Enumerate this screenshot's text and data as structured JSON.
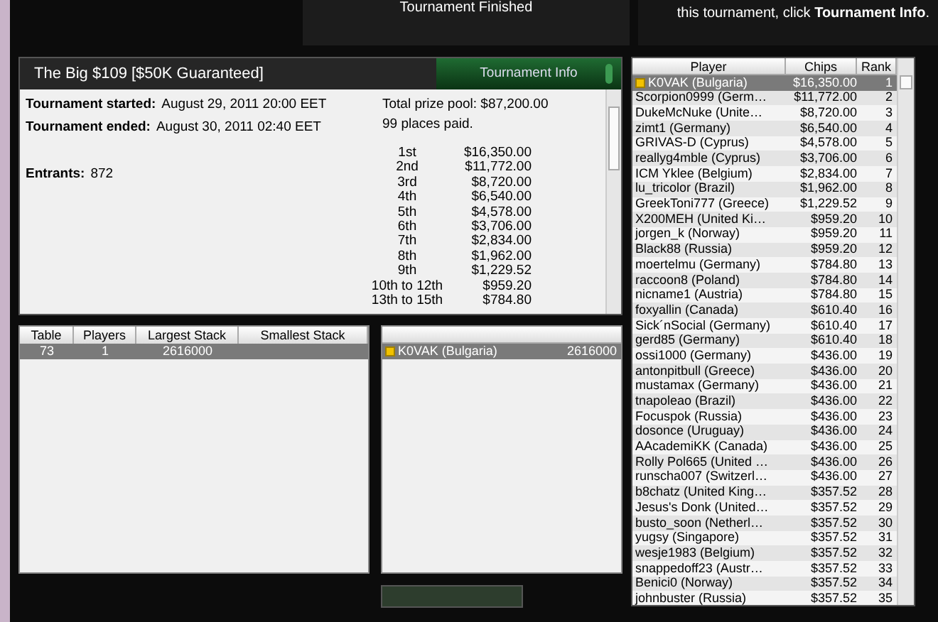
{
  "header": {
    "status": "Tournament Finished",
    "hint": "this tournament, click **Tournament Info**."
  },
  "info_panel": {
    "title": "The Big $109 [$50K Guaranteed]",
    "button": "Tournament Info",
    "fields": [
      {
        "label": "Tournament started:",
        "value": "August 29, 2011 20:00 EET"
      },
      {
        "label": "Tournament ended:",
        "value": "August 30, 2011 02:40 EET"
      },
      {
        "label": "Entrants:",
        "value": "872"
      }
    ],
    "prize_pool": "Total prize pool: $87,200.00",
    "places_paid": "99 places paid.",
    "payouts": [
      [
        "1st",
        "$16,350.00"
      ],
      [
        "2nd",
        "$11,772.00"
      ],
      [
        "3rd",
        "$8,720.00"
      ],
      [
        "4th",
        "$6,540.00"
      ],
      [
        "5th",
        "$4,578.00"
      ],
      [
        "6th",
        "$3,706.00"
      ],
      [
        "7th",
        "$2,834.00"
      ],
      [
        "8th",
        "$1,962.00"
      ],
      [
        "9th",
        "$1,229.52"
      ],
      [
        "10th to 12th",
        "$959.20"
      ],
      [
        "13th to 15th",
        "$784.80"
      ]
    ]
  },
  "tables": {
    "columns": [
      "Table",
      "Players",
      "Largest Stack",
      "Smallest Stack"
    ],
    "rows": [
      {
        "cells": [
          "73",
          "1",
          "2616000"
        ],
        "selected": true
      }
    ]
  },
  "table_players": [
    {
      "name": "K0VAK (Bulgaria)",
      "stack": "2616000",
      "selected": true,
      "hero": true
    }
  ],
  "players": {
    "columns": [
      "Player",
      "Chips",
      "Rank"
    ],
    "rows": [
      {
        "name": "K0VAK (Bulgaria)",
        "chips": "$16,350.00",
        "rank": "1",
        "selected": true,
        "hero": true
      },
      {
        "name": "Scorpion0999 (Germ…",
        "chips": "$11,772.00",
        "rank": "2",
        "selected": false,
        "hero": false
      },
      {
        "name": "DukeMcNuke (Unite…",
        "chips": "$8,720.00",
        "rank": "3",
        "selected": false,
        "hero": false
      },
      {
        "name": "zimt1 (Germany)",
        "chips": "$6,540.00",
        "rank": "4",
        "selected": false,
        "hero": false
      },
      {
        "name": "GRIVAS-D (Cyprus)",
        "chips": "$4,578.00",
        "rank": "5",
        "selected": false,
        "hero": false
      },
      {
        "name": "reallyg4mble (Cyprus)",
        "chips": "$3,706.00",
        "rank": "6",
        "selected": false,
        "hero": false
      },
      {
        "name": "ICM Yklee (Belgium)",
        "chips": "$2,834.00",
        "rank": "7",
        "selected": false,
        "hero": false
      },
      {
        "name": "lu_tricolor (Brazil)",
        "chips": "$1,962.00",
        "rank": "8",
        "selected": false,
        "hero": false
      },
      {
        "name": "GreekToni777 (Greece)",
        "chips": "$1,229.52",
        "rank": "9",
        "selected": false,
        "hero": false
      },
      {
        "name": "X200MEH (United Ki…",
        "chips": "$959.20",
        "rank": "10",
        "selected": false,
        "hero": false
      },
      {
        "name": "jorgen_k (Norway)",
        "chips": "$959.20",
        "rank": "11",
        "selected": false,
        "hero": false
      },
      {
        "name": "Black88 (Russia)",
        "chips": "$959.20",
        "rank": "12",
        "selected": false,
        "hero": false
      },
      {
        "name": "moertelmu (Germany)",
        "chips": "$784.80",
        "rank": "13",
        "selected": false,
        "hero": false
      },
      {
        "name": "raccoon8 (Poland)",
        "chips": "$784.80",
        "rank": "14",
        "selected": false,
        "hero": false
      },
      {
        "name": "nicname1 (Austria)",
        "chips": "$784.80",
        "rank": "15",
        "selected": false,
        "hero": false
      },
      {
        "name": "foxyallin (Canada)",
        "chips": "$610.40",
        "rank": "16",
        "selected": false,
        "hero": false
      },
      {
        "name": "Sick´nSocial (Germany)",
        "chips": "$610.40",
        "rank": "17",
        "selected": false,
        "hero": false
      },
      {
        "name": "gerd85 (Germany)",
        "chips": "$610.40",
        "rank": "18",
        "selected": false,
        "hero": false
      },
      {
        "name": "ossi1000 (Germany)",
        "chips": "$436.00",
        "rank": "19",
        "selected": false,
        "hero": false
      },
      {
        "name": "antonpitbull (Greece)",
        "chips": "$436.00",
        "rank": "20",
        "selected": false,
        "hero": false
      },
      {
        "name": "mustamax (Germany)",
        "chips": "$436.00",
        "rank": "21",
        "selected": false,
        "hero": false
      },
      {
        "name": "tnapoleao (Brazil)",
        "chips": "$436.00",
        "rank": "22",
        "selected": false,
        "hero": false
      },
      {
        "name": "Focuspok (Russia)",
        "chips": "$436.00",
        "rank": "23",
        "selected": false,
        "hero": false
      },
      {
        "name": "dosonce (Uruguay)",
        "chips": "$436.00",
        "rank": "24",
        "selected": false,
        "hero": false
      },
      {
        "name": "AAcademiKK (Canada)",
        "chips": "$436.00",
        "rank": "25",
        "selected": false,
        "hero": false
      },
      {
        "name": "Rolly Pol665 (United …",
        "chips": "$436.00",
        "rank": "26",
        "selected": false,
        "hero": false
      },
      {
        "name": "runscha007 (Switzerl…",
        "chips": "$436.00",
        "rank": "27",
        "selected": false,
        "hero": false
      },
      {
        "name": "b8chatz (United King…",
        "chips": "$357.52",
        "rank": "28",
        "selected": false,
        "hero": false
      },
      {
        "name": "Jesus's Donk (United…",
        "chips": "$357.52",
        "rank": "29",
        "selected": false,
        "hero": false
      },
      {
        "name": "busto_soon (Netherl…",
        "chips": "$357.52",
        "rank": "30",
        "selected": false,
        "hero": false
      },
      {
        "name": "yugsy (Singapore)",
        "chips": "$357.52",
        "rank": "31",
        "selected": false,
        "hero": false
      },
      {
        "name": "wesje1983 (Belgium)",
        "chips": "$357.52",
        "rank": "32",
        "selected": false,
        "hero": false
      },
      {
        "name": "snappedoff23 (Austr…",
        "chips": "$357.52",
        "rank": "33",
        "selected": false,
        "hero": false
      },
      {
        "name": "Benici0 (Norway)",
        "chips": "$357.52",
        "rank": "34",
        "selected": false,
        "hero": false
      },
      {
        "name": "johnbuster (Russia)",
        "chips": "$357.52",
        "rank": "35",
        "selected": false,
        "hero": false
      }
    ]
  }
}
